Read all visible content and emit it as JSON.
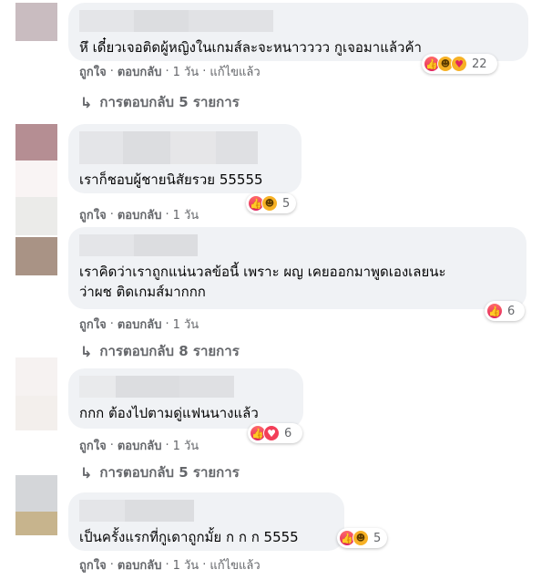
{
  "comments": [
    {
      "text": "หึ เดี๋ยวเจอติดผู้หญิงในเกมส์ละจะหนาวววว กูเจอมาแล้วค้า",
      "like_label": "ถูกใจ",
      "reply_label": "ตอบกลับ",
      "time": "1 วัน",
      "edited": "แก้ไขแล้ว",
      "reaction_count": "22",
      "reactions": [
        "like-icon",
        "haha-icon",
        "care-icon"
      ],
      "replies_label": "การตอบกลับ 5 รายการ"
    },
    {
      "text": "เราก็ชอบผู้ชายนิสัยรวย 55555",
      "like_label": "ถูกใจ",
      "reply_label": "ตอบกลับ",
      "time": "1 วัน",
      "reaction_count": "5",
      "reactions": [
        "like-icon",
        "haha-icon"
      ]
    },
    {
      "text": "เราคิดว่าเราถูกแน่นวลข้อนี้ เพราะ ผญ เคยออกมาพูดเองเลยนะ",
      "text2": "ว่าผช ติดเกมส์มากกก",
      "like_label": "ถูกใจ",
      "reply_label": "ตอบกลับ",
      "time": "1 วัน",
      "reaction_count": "6",
      "reactions": [
        "like-icon"
      ],
      "replies_label": "การตอบกลับ 8 รายการ"
    },
    {
      "text": "กกก ต้องไปตามดู่แฟนนางแล้ว",
      "like_label": "ถูกใจ",
      "reply_label": "ตอบกลับ",
      "time": "1 วัน",
      "reaction_count": "6",
      "reactions": [
        "like-icon",
        "love-icon"
      ],
      "replies_label": "การตอบกลับ 5 รายการ"
    },
    {
      "text": "เป็นครั้งแรกที่กูเดาถูกมั้ย ก ก ก 5555",
      "like_label": "ถูกใจ",
      "reply_label": "ตอบกลับ",
      "time": "1 วัน",
      "edited": "แก้ไขแล้ว",
      "reaction_count": "5",
      "reactions": [
        "like-icon",
        "haha-icon"
      ]
    }
  ],
  "colors": {
    "bubble": "#f0f2f5",
    "meta": "#65676b",
    "text": "#050505"
  }
}
